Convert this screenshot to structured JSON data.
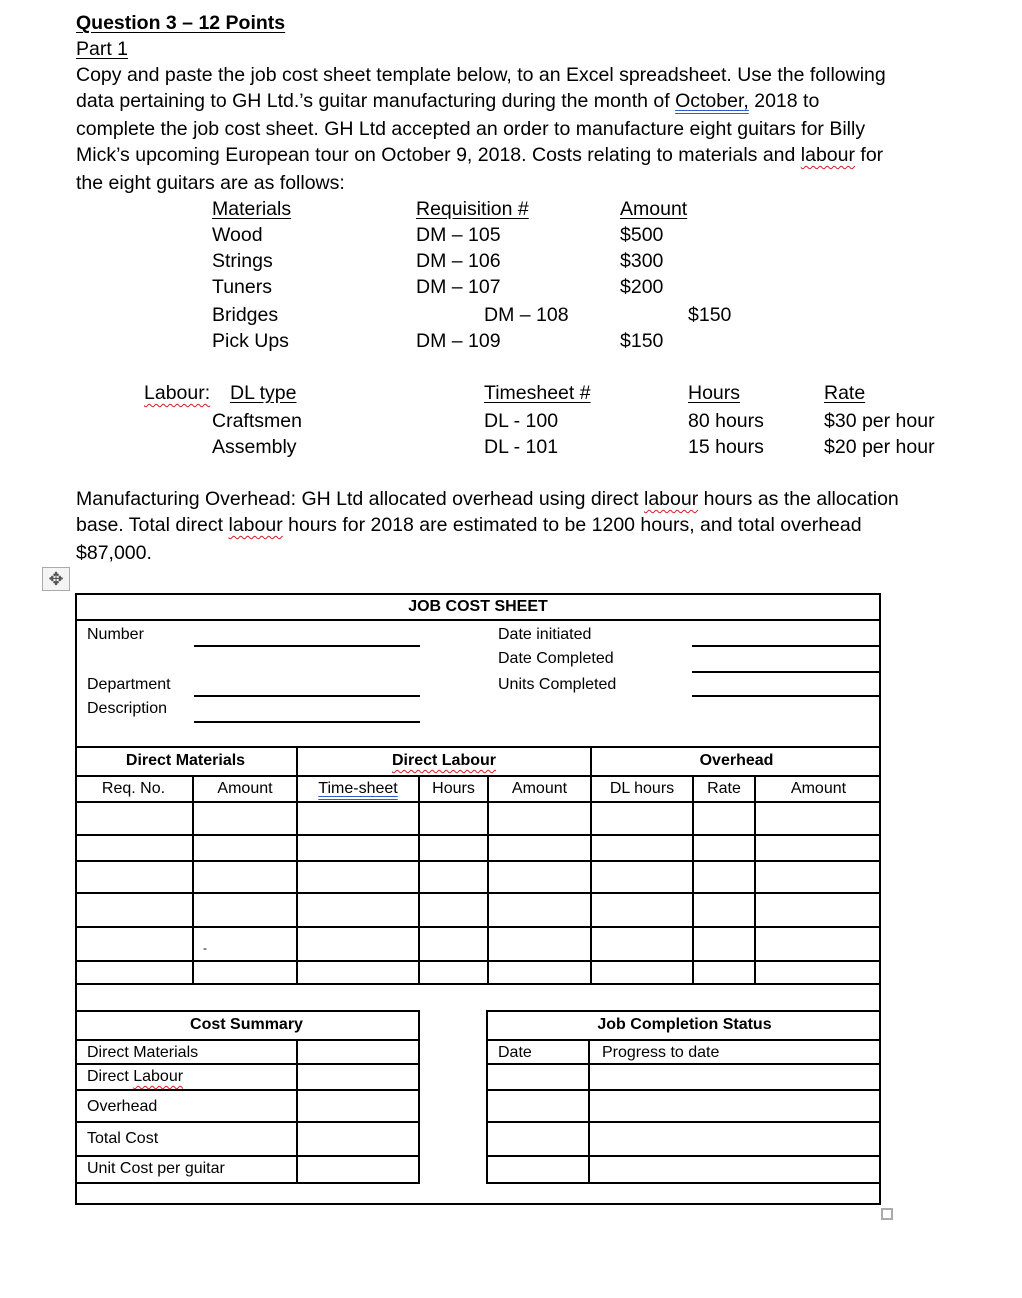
{
  "question": {
    "title": "Question 3 – 12 Points",
    "part": "Part 1",
    "intro_lines": [
      "Copy and paste the job cost sheet template below, to an Excel spreadsheet. Use the following",
      "data pertaining to GH Ltd.’s guitar manufacturing during the month of ",
      "complete the job cost sheet.  GH Ltd accepted an order to manufacture eight guitars for Billy",
      "Mick’s upcoming European tour on October 9, 2018.   Costs relating to materials and ",
      "the eight guitars are as follows:"
    ],
    "intro_month": "October,",
    "intro_line2_end": " 2018 to",
    "intro_labour": "labour",
    "intro_line4_end": " for"
  },
  "materials": {
    "headers": [
      "Materials",
      "Requisition #",
      "Amount"
    ],
    "rows": [
      {
        "item": "Wood",
        "req": "DM – 105",
        "amount": "$500"
      },
      {
        "item": "Strings",
        "req": "DM – 106",
        "amount": "$300"
      },
      {
        "item": "Tuners",
        "req": "DM – 107",
        "amount": "$200"
      },
      {
        "item": "Bridges",
        "req": "DM – 108",
        "amount": "$150"
      },
      {
        "item": "Pick Ups",
        "req": "DM – 109",
        "amount": "$150"
      }
    ]
  },
  "labour": {
    "label": "Labour:",
    "headers": [
      "DL type",
      "Timesheet #",
      "Hours",
      "Rate"
    ],
    "rows": [
      {
        "type": "Craftsmen",
        "timesheet": "DL - 100",
        "hours": "80 hours",
        "rate": "$30 per hour"
      },
      {
        "type": "Assembly",
        "timesheet": "DL - 101",
        "hours": "15 hours",
        "rate": "$20 per hour"
      }
    ]
  },
  "overhead_text": {
    "line1a": "Manufacturing Overhead:  GH Ltd allocated overhead using direct ",
    "labour": "labour",
    "line1b": " hours as the allocation",
    "line2a": "base. Total direct ",
    "line2b": " hours for 2018 are estimated to be 1200 hours, and total overhead",
    "line3": "$87,000."
  },
  "sheet": {
    "title": "JOB COST SHEET",
    "number_label": "Number",
    "department_label": "Department",
    "description_label": "Description",
    "date_initiated_label": "Date initiated",
    "date_completed_label": "Date Completed",
    "units_completed_label": "Units Completed",
    "groups": [
      "Direct Materials",
      "Direct Labour",
      "Overhead"
    ],
    "columns": [
      "Req. No.",
      "Amount",
      "Time-sheet",
      "Hours",
      "Amount",
      "DL hours",
      "Rate",
      "Amount"
    ],
    "stray_mark": "-",
    "cost_summary": {
      "title": "Cost Summary",
      "rows": [
        "Direct Materials",
        "Direct Labour",
        "Overhead",
        "Total Cost",
        "Unit Cost per guitar"
      ]
    },
    "completion": {
      "title": "Job Completion Status",
      "date_label": "Date",
      "progress_label": "Progress to date"
    }
  },
  "icons": {
    "move": "✥"
  }
}
